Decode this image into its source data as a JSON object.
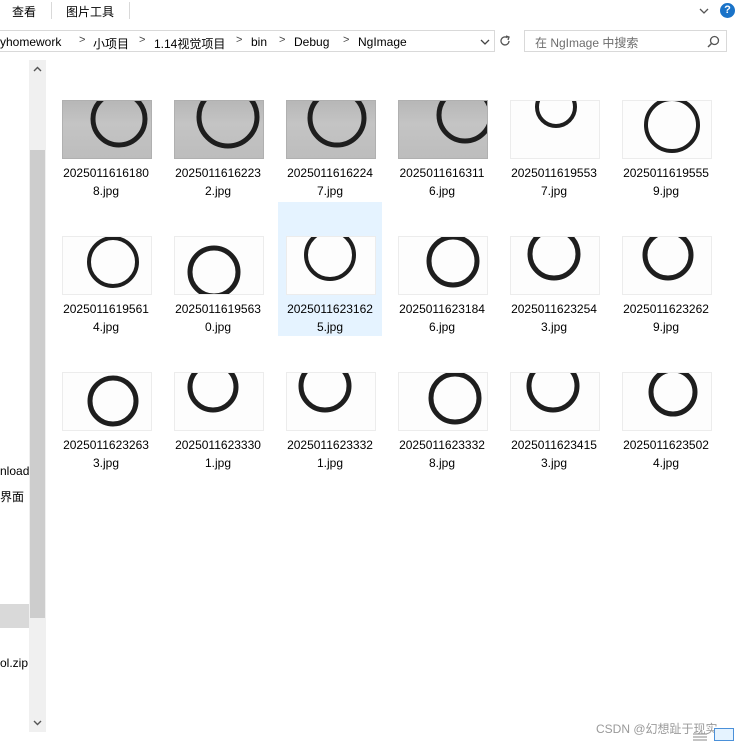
{
  "ribbon": {
    "tabs": [
      "查看",
      "图片工具"
    ]
  },
  "address": {
    "crumbs": [
      "yhomework",
      "小项目",
      "1.14视觉项目",
      "bin",
      "Debug",
      "NgImage"
    ]
  },
  "search": {
    "placeholder": "在 NgImage 中搜索"
  },
  "nav": {
    "items": [
      "nload",
      "界面",
      "ol.zip"
    ]
  },
  "files": [
    {
      "l1": "2025011616180",
      "l2": "8.jpg"
    },
    {
      "l1": "2025011616223",
      "l2": "2.jpg"
    },
    {
      "l1": "2025011616224",
      "l2": "7.jpg"
    },
    {
      "l1": "2025011616311",
      "l2": "6.jpg"
    },
    {
      "l1": "2025011619553",
      "l2": "7.jpg"
    },
    {
      "l1": "2025011619555",
      "l2": "9.jpg"
    },
    {
      "l1": "2025011619561",
      "l2": "4.jpg"
    },
    {
      "l1": "2025011619563",
      "l2": "0.jpg"
    },
    {
      "l1": "2025011623162",
      "l2": "5.jpg"
    },
    {
      "l1": "2025011623184",
      "l2": "6.jpg"
    },
    {
      "l1": "2025011623254",
      "l2": "3.jpg"
    },
    {
      "l1": "2025011623262",
      "l2": "9.jpg"
    },
    {
      "l1": "2025011623263",
      "l2": "3.jpg"
    },
    {
      "l1": "2025011623330",
      "l2": "1.jpg"
    },
    {
      "l1": "2025011623332",
      "l2": "1.jpg"
    },
    {
      "l1": "2025011623332",
      "l2": "8.jpg"
    },
    {
      "l1": "2025011623415",
      "l2": "3.jpg"
    },
    {
      "l1": "2025011623502",
      "l2": "4.jpg"
    }
  ],
  "watermark": "CSDN @幻想趾于现实",
  "colors": {
    "selection": "#e5f3ff",
    "accent": "#1a73c8"
  }
}
